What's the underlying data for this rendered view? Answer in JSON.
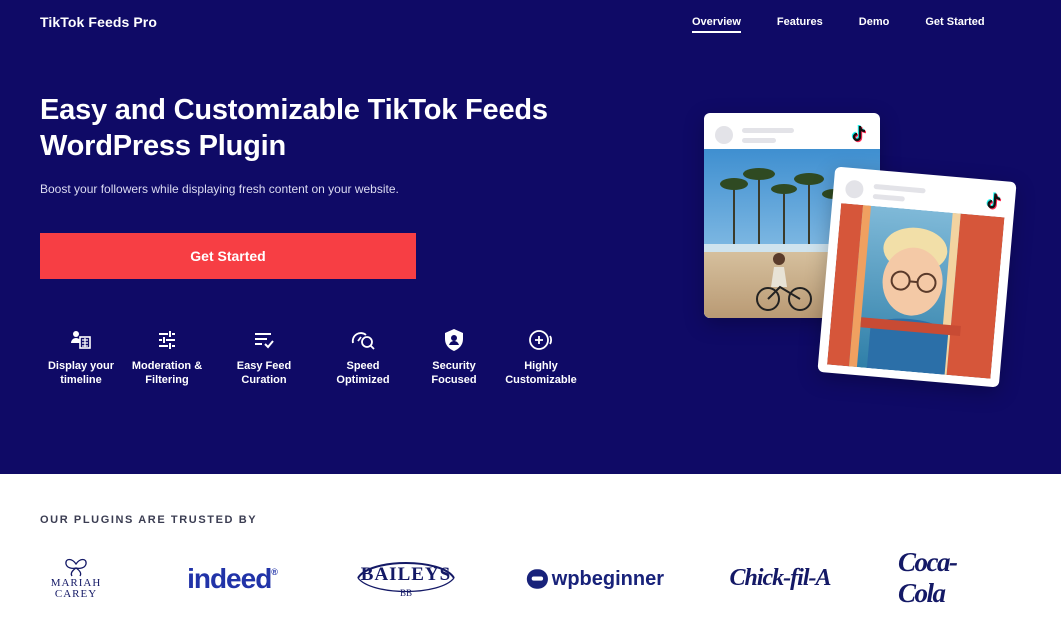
{
  "header": {
    "brand": "TikTok Feeds Pro",
    "nav": [
      {
        "label": "Overview",
        "active": true
      },
      {
        "label": "Features",
        "active": false
      },
      {
        "label": "Demo",
        "active": false
      },
      {
        "label": "Get Started",
        "active": false
      }
    ]
  },
  "hero": {
    "title": "Easy and Customizable TikTok Feeds WordPress Plugin",
    "subtitle": "Boost your followers while displaying fresh content on your website.",
    "cta_label": "Get Started"
  },
  "features": [
    {
      "label_1": "Display your",
      "label_2": "timeline",
      "icon": "display-timeline-icon"
    },
    {
      "label_1": "Moderation  &",
      "label_2": "Filtering",
      "icon": "sliders-icon"
    },
    {
      "label_1": "Easy Feed",
      "label_2": "Curation",
      "icon": "list-check-icon"
    },
    {
      "label_1": "Speed",
      "label_2": "Optimized",
      "icon": "speed-search-icon"
    },
    {
      "label_1": "Security",
      "label_2": "Focused",
      "icon": "shield-user-icon"
    },
    {
      "label_1": "Highly",
      "label_2": "Customizable",
      "icon": "plus-sound-icon"
    }
  ],
  "trusted": {
    "heading": "OUR PLUGINS ARE TRUSTED BY",
    "logos": [
      {
        "name": "mariah-carey-logo",
        "line_1": "MARIAH",
        "line_2": "CAREY"
      },
      {
        "name": "indeed-logo",
        "text": "indeed"
      },
      {
        "name": "baileys-logo",
        "text": "BAILEYS"
      },
      {
        "name": "wpbeginner-logo",
        "text": "wpbeginner"
      },
      {
        "name": "chick-fil-a-logo",
        "text": "Chick-fil-A"
      },
      {
        "name": "coca-cola-logo",
        "text": "Coca-Cola"
      }
    ]
  },
  "colors": {
    "hero_bg": "#0f0a66",
    "cta": "#f73e44",
    "logo": "#141966"
  }
}
